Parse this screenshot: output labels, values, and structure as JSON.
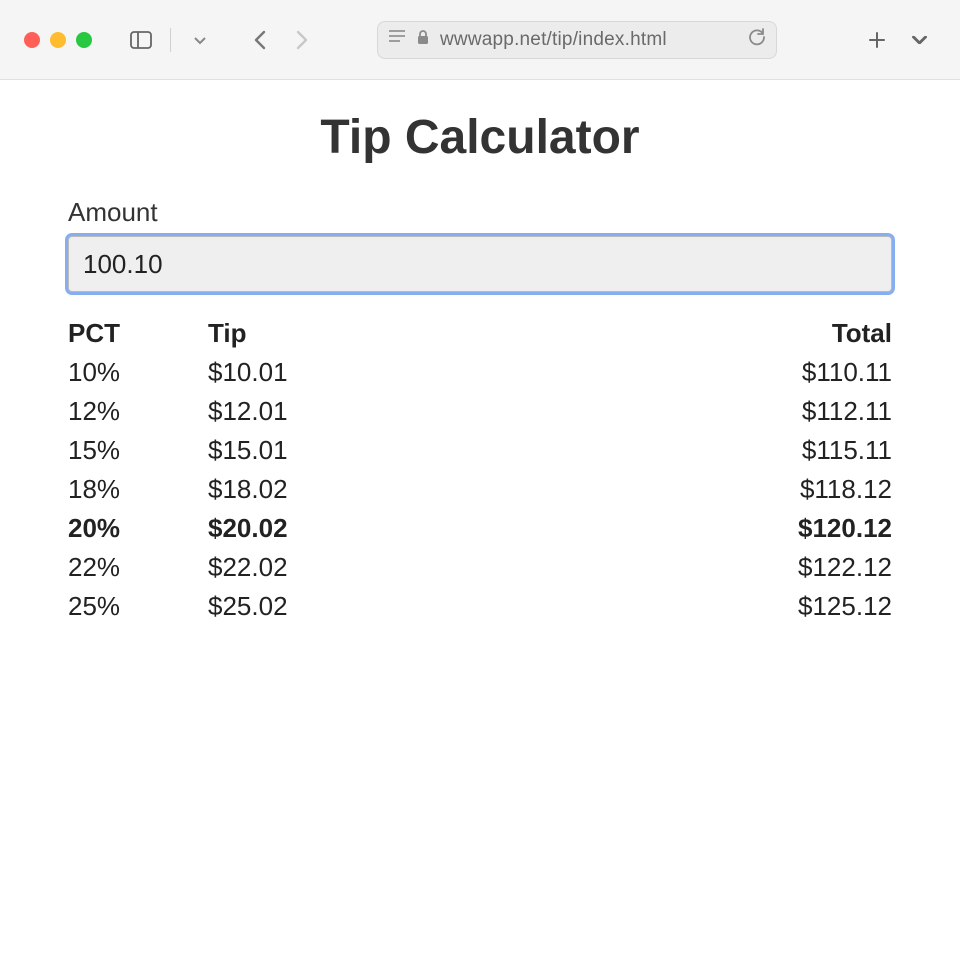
{
  "browser": {
    "url": "wwwapp.net/tip/index.html"
  },
  "page": {
    "title": "Tip Calculator",
    "amount_label": "Amount",
    "amount_value": "100.10",
    "columns": {
      "pct": "PCT",
      "tip": "Tip",
      "total": "Total"
    },
    "rows": [
      {
        "pct": "10%",
        "tip": "$10.01",
        "total": "$110.11",
        "bold": false
      },
      {
        "pct": "12%",
        "tip": "$12.01",
        "total": "$112.11",
        "bold": false
      },
      {
        "pct": "15%",
        "tip": "$15.01",
        "total": "$115.11",
        "bold": false
      },
      {
        "pct": "18%",
        "tip": "$18.02",
        "total": "$118.12",
        "bold": false
      },
      {
        "pct": "20%",
        "tip": "$20.02",
        "total": "$120.12",
        "bold": true
      },
      {
        "pct": "22%",
        "tip": "$22.02",
        "total": "$122.12",
        "bold": false
      },
      {
        "pct": "25%",
        "tip": "$25.02",
        "total": "$125.12",
        "bold": false
      }
    ]
  }
}
